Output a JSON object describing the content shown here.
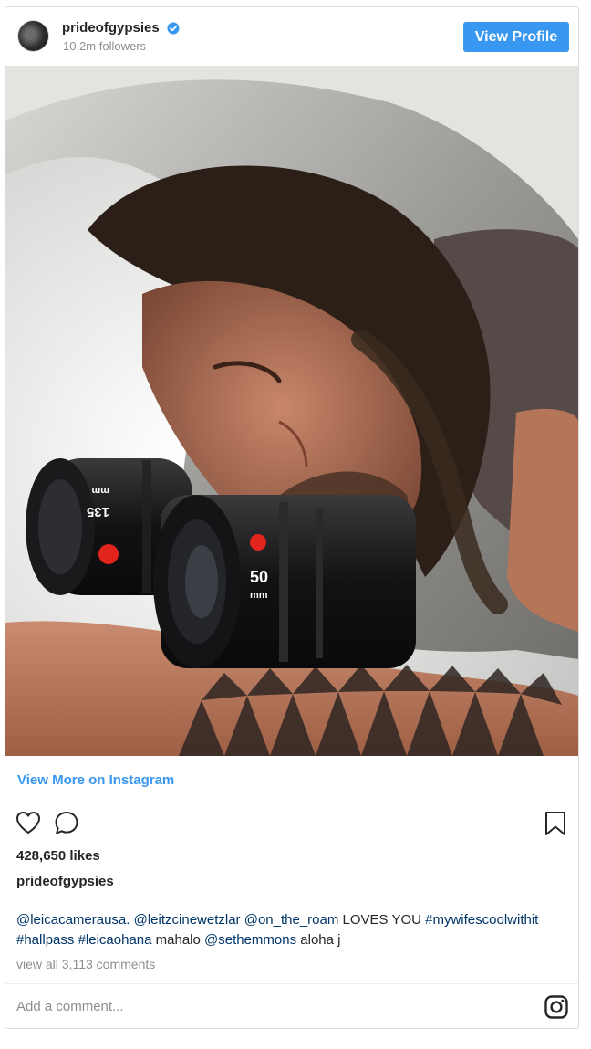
{
  "header": {
    "username": "prideofgypsies",
    "followers": "10.2m followers",
    "view_profile_label": "View Profile"
  },
  "post": {
    "view_more_label": "View More on Instagram",
    "likes": "428,650 likes",
    "caption_user": "prideofgypsies",
    "caption_parts": [
      {
        "text": "@leicacamerausa.",
        "tag": true
      },
      {
        "text": " ",
        "tag": false
      },
      {
        "text": "@leitzcinewetzlar",
        "tag": true
      },
      {
        "text": " ",
        "tag": false
      },
      {
        "text": "@on_the_roam",
        "tag": true
      },
      {
        "text": " LOVES YOU ",
        "tag": false
      },
      {
        "text": "#mywifescoolwithit",
        "tag": true
      },
      {
        "text": " ",
        "tag": false
      },
      {
        "text": "#hallpass",
        "tag": true
      },
      {
        "text": " ",
        "tag": false
      },
      {
        "text": "#leicaohana",
        "tag": true
      },
      {
        "text": " mahalo ",
        "tag": false
      },
      {
        "text": "@sethemmons",
        "tag": true
      },
      {
        "text": " aloha j",
        "tag": false
      }
    ],
    "comments_label": "view all 3,113 comments",
    "add_comment_placeholder": "Add a comment...",
    "photo": {
      "lens_left_focal": "135",
      "lens_left_unit": "mm",
      "lens_right_focal": "50",
      "lens_right_unit": "mm"
    }
  },
  "icons": {
    "verified": "verified-badge-icon",
    "like": "heart-icon",
    "comment": "comment-bubble-icon",
    "save": "bookmark-icon",
    "instagram": "instagram-logo-icon"
  },
  "colors": {
    "accent": "#3897f0",
    "link": "#003569",
    "muted": "#8e8e8e",
    "text": "#262626"
  }
}
